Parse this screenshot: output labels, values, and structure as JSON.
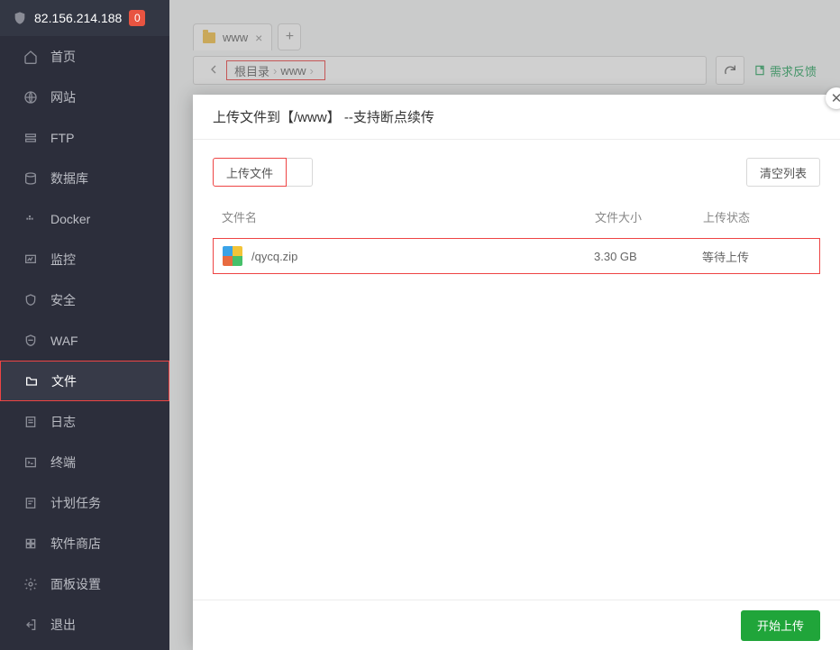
{
  "header": {
    "ip": "82.156.214.188",
    "badge": "0"
  },
  "sidebar": {
    "items": [
      {
        "label": "首页",
        "icon": "home"
      },
      {
        "label": "网站",
        "icon": "globe"
      },
      {
        "label": "FTP",
        "icon": "ftp"
      },
      {
        "label": "数据库",
        "icon": "db"
      },
      {
        "label": "Docker",
        "icon": "docker"
      },
      {
        "label": "监控",
        "icon": "monitor"
      },
      {
        "label": "安全",
        "icon": "shield"
      },
      {
        "label": "WAF",
        "icon": "waf"
      },
      {
        "label": "文件",
        "icon": "folder"
      },
      {
        "label": "日志",
        "icon": "log"
      },
      {
        "label": "终端",
        "icon": "terminal"
      },
      {
        "label": "计划任务",
        "icon": "cron"
      },
      {
        "label": "软件商店",
        "icon": "store"
      },
      {
        "label": "面板设置",
        "icon": "gear"
      },
      {
        "label": "退出",
        "icon": "exit"
      }
    ]
  },
  "tabs": {
    "items": [
      {
        "label": "www"
      }
    ]
  },
  "breadcrumb": {
    "root": "根目录",
    "segments": [
      "www"
    ]
  },
  "feedback": "需求反馈",
  "dialog": {
    "title": "上传文件到【/www】 --支持断点续传",
    "upload_btn": "上传文件",
    "clear_btn": "清空列表",
    "cols": {
      "name": "文件名",
      "size": "文件大小",
      "status": "上传状态"
    },
    "rows": [
      {
        "name": "/qycq.zip",
        "size": "3.30 GB",
        "status": "等待上传"
      }
    ],
    "start_btn": "开始上传"
  }
}
